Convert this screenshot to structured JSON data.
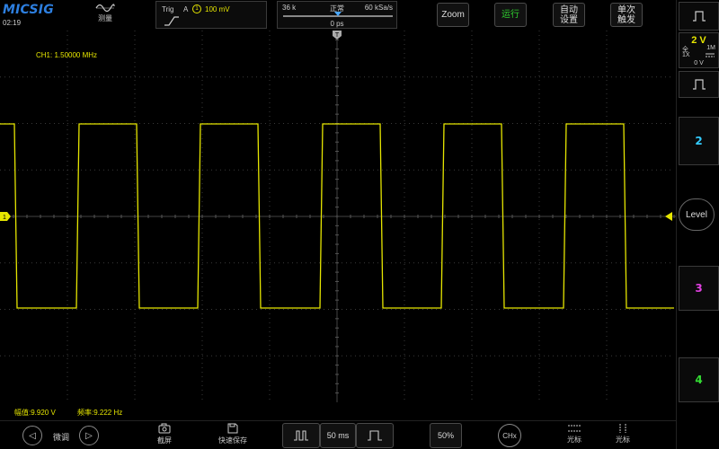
{
  "brand": {
    "logo": "MICSIG"
  },
  "status": {
    "time": "02:19"
  },
  "toolbar": {
    "measure_label": "测量",
    "zoom_label": "Zoom",
    "run_label": "运行",
    "auto_label_1": "自动",
    "auto_label_2": "设置",
    "single_label_1": "单次",
    "single_label_2": "触发"
  },
  "trigger": {
    "label": "Trig",
    "source_letter": "A",
    "channel": "1",
    "level": "100 mV",
    "slope_icon": "rising-edge-icon"
  },
  "timebase_info": {
    "memory_depth": "36 k",
    "mode": "正常",
    "sample_rate": "60 kSa/s",
    "position": "0 ps"
  },
  "channels": {
    "ch1": {
      "scale": "2 V",
      "coupling_full": "全",
      "probe": "1X",
      "impedance": "1M",
      "offset": "0 V",
      "marker": "1",
      "color": "#e6e600"
    },
    "ch2": {
      "label": "2",
      "color": "#33ccff"
    },
    "ch3": {
      "label": "3",
      "color": "#e040e0"
    },
    "ch4": {
      "label": "4",
      "color": "#33dd33"
    }
  },
  "display": {
    "freq_readout": "CH1: 1.50000 MHz",
    "trigger_marker": "T"
  },
  "level_button": "Level",
  "measurements": {
    "amplitude": "幅值:9.920 V",
    "frequency": "频率:9.222 Hz"
  },
  "bottom": {
    "fine_label": "微调",
    "screenshot_label": "截屏",
    "quicksave_label": "快速保存",
    "timebase": "50 ms",
    "trigger_percent": "50%",
    "chx_label": "CHx",
    "cursor_h_label": "光标",
    "cursor_v_label": "光标"
  }
}
